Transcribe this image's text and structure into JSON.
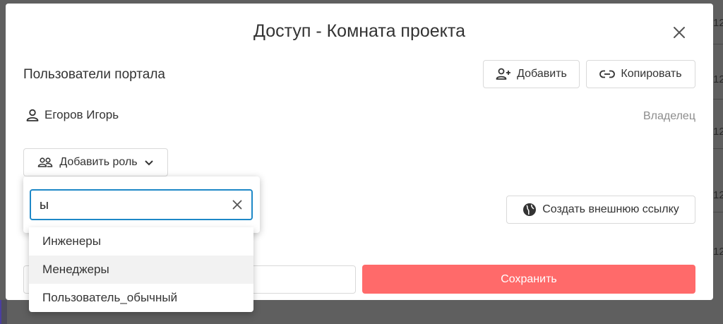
{
  "background": {
    "row_fragments": [
      "12",
      "12",
      "12",
      "12",
      "12"
    ]
  },
  "dialog": {
    "title": "Доступ - Комната проекта",
    "close_icon": "close-icon",
    "section_title": "Пользователи портала",
    "add_button_label": "Добавить",
    "copy_button_label": "Копировать",
    "user": {
      "name": "Егоров Игорь",
      "role": "Владелец"
    },
    "add_role_label": "Добавить роль",
    "external_link_label": "Создать внешнюю ссылку",
    "save_label": "Сохранить"
  },
  "role_dropdown": {
    "search_value": "ы",
    "options": [
      "Инженеры",
      "Менеджеры",
      "Пользователь_обычный"
    ],
    "hovered_index": 1
  },
  "colors": {
    "accent_focus": "#1e88c7",
    "save_button": "#ff6a6a",
    "overlay": "#5f5f5f"
  }
}
